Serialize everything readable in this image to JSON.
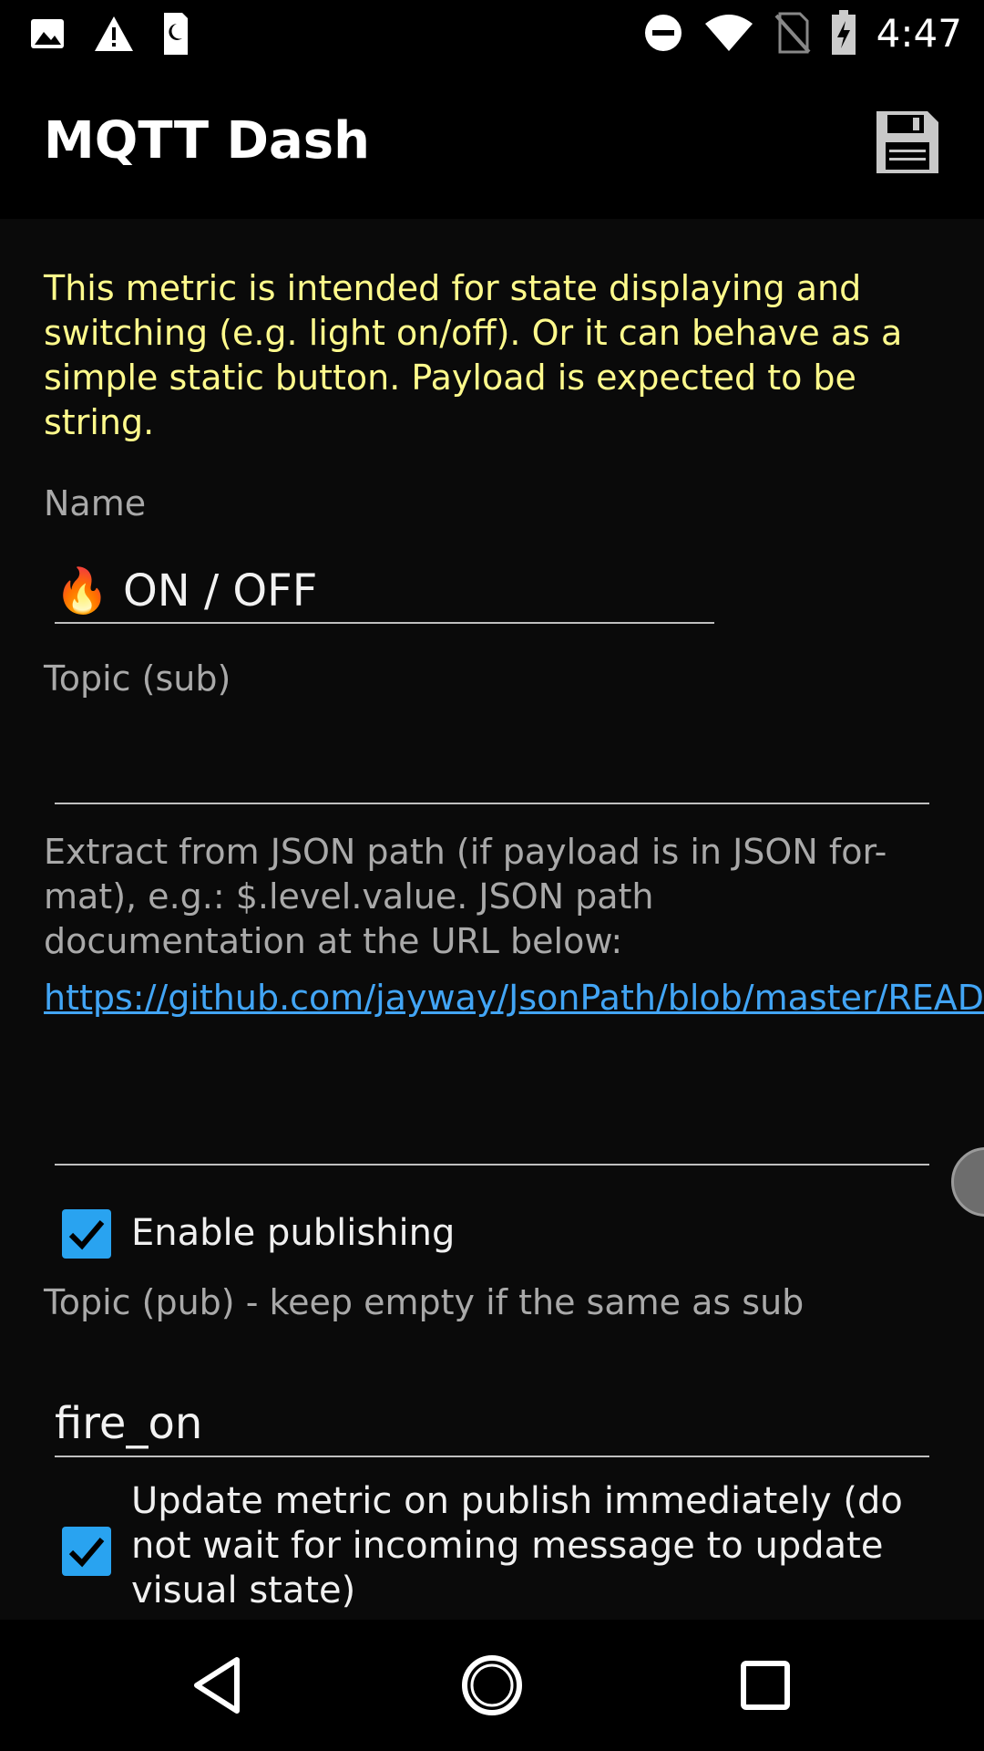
{
  "status_bar": {
    "time": "4:47",
    "left_icons": [
      "image-icon",
      "warning-icon",
      "sim-card-icon"
    ],
    "right_icons": [
      "do-not-disturb-icon",
      "wifi-icon",
      "no-sim-icon",
      "battery-charging-icon"
    ]
  },
  "app_bar": {
    "title": "MQTT Dash",
    "save_icon": "save-icon"
  },
  "form": {
    "intro": "This metric is intended for state displaying and switching (e.g. light on/off). Or it can behave as a simple static button. Payload is expected to be string.",
    "name_label": "Name",
    "name_value": "🔥 ON / OFF",
    "topic_sub_label": "Topic (sub)",
    "topic_sub_value": "",
    "json_path_help": "Extract from JSON path (if payload is in JSON for-mat), e.g.: $.level.value. JSON path documentation at the URL below:",
    "json_path_link": "https://github.com/jayway/JsonPath/blob/master/README.md",
    "json_path_value": "",
    "enable_publishing_label": "Enable publishing",
    "enable_publishing_checked": true,
    "topic_pub_label": "Topic (pub) - keep empty if the same as sub",
    "topic_pub_value": "fire_on",
    "update_metric_label": "Update metric on publish immediately (do not wait for incoming message to update visual state)",
    "update_metric_checked": true
  },
  "colors": {
    "intro_text": "#fffa8c",
    "link": "#42a5f5",
    "checkbox": "#29a3f0",
    "background": "#0a0a0a"
  },
  "nav_bar": {
    "icons": [
      "back-icon",
      "home-icon",
      "recents-icon"
    ]
  }
}
